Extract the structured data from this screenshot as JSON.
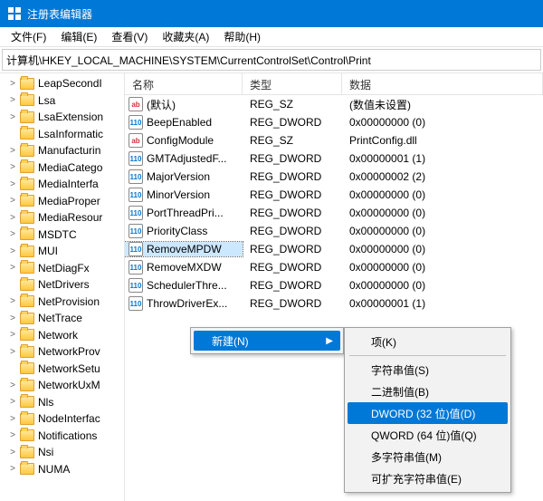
{
  "title": "注册表编辑器",
  "menus": [
    "文件(F)",
    "编辑(E)",
    "查看(V)",
    "收藏夹(A)",
    "帮助(H)"
  ],
  "address": "计算机\\HKEY_LOCAL_MACHINE\\SYSTEM\\CurrentControlSet\\Control\\Print",
  "tree": [
    {
      "label": "LeapSecondI",
      "exp": ">"
    },
    {
      "label": "Lsa",
      "exp": ">"
    },
    {
      "label": "LsaExtension",
      "exp": ">"
    },
    {
      "label": "LsaInformatic",
      "exp": ""
    },
    {
      "label": "Manufacturin",
      "exp": ">"
    },
    {
      "label": "MediaCatego",
      "exp": ">"
    },
    {
      "label": "MediaInterfa",
      "exp": ">"
    },
    {
      "label": "MediaProper",
      "exp": ">"
    },
    {
      "label": "MediaResour",
      "exp": ">"
    },
    {
      "label": "MSDTC",
      "exp": ">"
    },
    {
      "label": "MUI",
      "exp": ">"
    },
    {
      "label": "NetDiagFx",
      "exp": ">"
    },
    {
      "label": "NetDrivers",
      "exp": ""
    },
    {
      "label": "NetProvision",
      "exp": ">"
    },
    {
      "label": "NetTrace",
      "exp": ">"
    },
    {
      "label": "Network",
      "exp": ">"
    },
    {
      "label": "NetworkProv",
      "exp": ">"
    },
    {
      "label": "NetworkSetu",
      "exp": ""
    },
    {
      "label": "NetworkUxM",
      "exp": ">"
    },
    {
      "label": "Nls",
      "exp": ">"
    },
    {
      "label": "NodeInterfac",
      "exp": ">"
    },
    {
      "label": "Notifications",
      "exp": ">"
    },
    {
      "label": "Nsi",
      "exp": ">"
    },
    {
      "label": "NUMA",
      "exp": ">"
    }
  ],
  "columns": {
    "name": "名称",
    "type": "类型",
    "data": "数据"
  },
  "values": [
    {
      "icon": "str",
      "name": "(默认)",
      "type": "REG_SZ",
      "data": "(数值未设置)"
    },
    {
      "icon": "bin",
      "name": "BeepEnabled",
      "type": "REG_DWORD",
      "data": "0x00000000 (0)"
    },
    {
      "icon": "str",
      "name": "ConfigModule",
      "type": "REG_SZ",
      "data": "PrintConfig.dll"
    },
    {
      "icon": "bin",
      "name": "GMTAdjustedF...",
      "type": "REG_DWORD",
      "data": "0x00000001 (1)"
    },
    {
      "icon": "bin",
      "name": "MajorVersion",
      "type": "REG_DWORD",
      "data": "0x00000002 (2)"
    },
    {
      "icon": "bin",
      "name": "MinorVersion",
      "type": "REG_DWORD",
      "data": "0x00000000 (0)"
    },
    {
      "icon": "bin",
      "name": "PortThreadPri...",
      "type": "REG_DWORD",
      "data": "0x00000000 (0)"
    },
    {
      "icon": "bin",
      "name": "PriorityClass",
      "type": "REG_DWORD",
      "data": "0x00000000 (0)"
    },
    {
      "icon": "bin",
      "name": "RemoveMPDW",
      "type": "REG_DWORD",
      "data": "0x00000000 (0)",
      "selected": true
    },
    {
      "icon": "bin",
      "name": "RemoveMXDW",
      "type": "REG_DWORD",
      "data": "0x00000000 (0)"
    },
    {
      "icon": "bin",
      "name": "SchedulerThre...",
      "type": "REG_DWORD",
      "data": "0x00000000 (0)"
    },
    {
      "icon": "bin",
      "name": "ThrowDriverEx...",
      "type": "REG_DWORD",
      "data": "0x00000001 (1)"
    }
  ],
  "context": {
    "new_label": "新建(N)",
    "items": [
      {
        "label": "项(K)"
      },
      {
        "sep": true
      },
      {
        "label": "字符串值(S)"
      },
      {
        "label": "二进制值(B)"
      },
      {
        "label": "DWORD (32 位)值(D)",
        "hover": true
      },
      {
        "label": "QWORD (64 位)值(Q)"
      },
      {
        "label": "多字符串值(M)"
      },
      {
        "label": "可扩充字符串值(E)"
      }
    ]
  },
  "icon_glyph": {
    "str": "ab",
    "bin": "110"
  }
}
